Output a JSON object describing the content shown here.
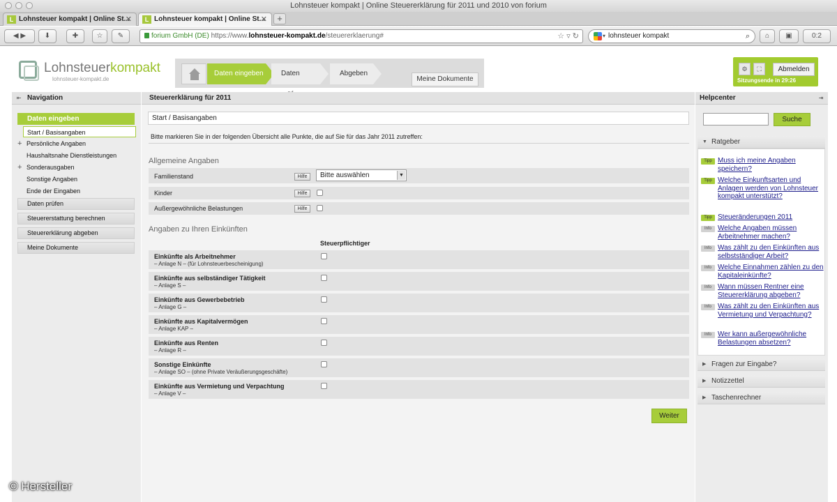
{
  "window": {
    "title": "Lohnsteuer kompakt | Online Steuererklärung für 2011 und 2010 von forium"
  },
  "browser": {
    "tabs": [
      {
        "label": "Lohnsteuer kompakt | Online St..."
      },
      {
        "label": "Lohnsteuer kompakt | Online St..."
      }
    ],
    "site_identity": "forium GmbH (DE)",
    "url_scheme": "https://www.",
    "url_domain": "lohnsteuer-kompakt.de",
    "url_path": "/steuererklaerung#",
    "search_value": "lohnsteuer kompakt",
    "addon_count": "0:2"
  },
  "brand": {
    "name_plain": "Lohnsteuer",
    "name_accent": "kompakt",
    "domain": "lohnsteuer-kompakt.de"
  },
  "steps": [
    "Daten eingeben",
    "Daten prüfen",
    "Abgeben"
  ],
  "my_documents_button": "Meine Dokumente",
  "session": {
    "logout": "Abmelden",
    "timer": "Sitzungsende in 29:26"
  },
  "left_panel": {
    "title": "Navigation",
    "active_section": "Daten eingeben",
    "sub_items": [
      {
        "label": "Start / Basisangaben",
        "current": true,
        "expandable": false
      },
      {
        "label": "Persönliche Angaben",
        "expandable": true
      },
      {
        "label": "Haushaltsnahe Dienstleistungen",
        "expandable": false
      },
      {
        "label": "Sonderausgaben",
        "expandable": true
      },
      {
        "label": "Sonstige Angaben",
        "expandable": false
      },
      {
        "label": "Ende der Eingaben",
        "expandable": false
      }
    ],
    "items": [
      "Daten prüfen",
      "Steuererstattung berechnen",
      "Steuererklärung abgeben",
      "Meine Dokumente"
    ]
  },
  "main": {
    "title": "Steuererklärung für 2011",
    "breadcrumb": "Start / Basisangaben",
    "intro": "Bitte markieren Sie in der folgenden Übersicht alle Punkte, die auf Sie für das Jahr 2011 zutreffen:",
    "general_heading": "Allgemeine Angaben",
    "general_rows": [
      {
        "label": "Familienstand",
        "help": "Hilfe",
        "select": "Bitte auswählen"
      },
      {
        "label": "Kinder",
        "help": "Hilfe"
      },
      {
        "label": "Außergewöhnliche Belastungen",
        "help": "Hilfe"
      }
    ],
    "income_heading": "Angaben zu Ihren Einkünften",
    "taxpayer_column": "Steuerpflichtiger",
    "income_rows": [
      {
        "title": "Einkünfte als Arbeitnehmer",
        "subtitle": "– Anlage N – (für Lohnsteuerbescheinigung)"
      },
      {
        "title": "Einkünfte aus selbständiger Tätigkeit",
        "subtitle": "– Anlage S –"
      },
      {
        "title": "Einkünfte aus Gewerbebetrieb",
        "subtitle": "– Anlage G –"
      },
      {
        "title": "Einkünfte aus Kapitalvermögen",
        "subtitle": "– Anlage KAP –"
      },
      {
        "title": "Einkünfte aus Renten",
        "subtitle": "– Anlage R –"
      },
      {
        "title": "Sonstige Einkünfte",
        "subtitle": "– Anlage SO – (ohne Private Veräußerungsgeschäfte)"
      },
      {
        "title": "Einkünfte aus Vermietung und Verpachtung",
        "subtitle": "– Anlage V –"
      }
    ],
    "next_button": "Weiter"
  },
  "help_center": {
    "title": "Helpcenter",
    "search_placeholder": "",
    "search_button": "Suche",
    "advisor_title": "Ratgeber",
    "articles": [
      {
        "badge": "Tipp",
        "text": "Muss ich meine Angaben speichern?"
      },
      {
        "badge": "Tipp",
        "text": "Welche Einkunftsarten und Anlagen werden von Lohnsteuer kompakt unterstützt?"
      },
      {
        "badge": "Tipp",
        "text": "Steueränderungen 2011"
      },
      {
        "badge": "Info",
        "text": "Welche Angaben müssen Arbeitnehmer machen?"
      },
      {
        "badge": "Info",
        "text": "Was zählt zu den Einkünften aus selbstständiger Arbeit?"
      },
      {
        "badge": "Info",
        "text": "Welche Einnahmen zählen zu den Kapitaleinkünfte?"
      },
      {
        "badge": "Info",
        "text": "Wann müssen Rentner eine Steuererklärung abgeben?"
      },
      {
        "badge": "Info",
        "text": "Was zählt zu den Einkünften aus Vermietung und Verpachtung?"
      },
      {
        "badge": "Info",
        "text": "Wer kann außergewöhnliche Belastungen absetzen?"
      }
    ],
    "sections": [
      "Fragen zur Eingabe?",
      "Notizzettel",
      "Taschenrechner"
    ]
  },
  "watermark": "© Hersteller",
  "colors": {
    "accent": "#a7cd3a",
    "panel": "#e2e2e2",
    "link": "#1a1a8a"
  }
}
